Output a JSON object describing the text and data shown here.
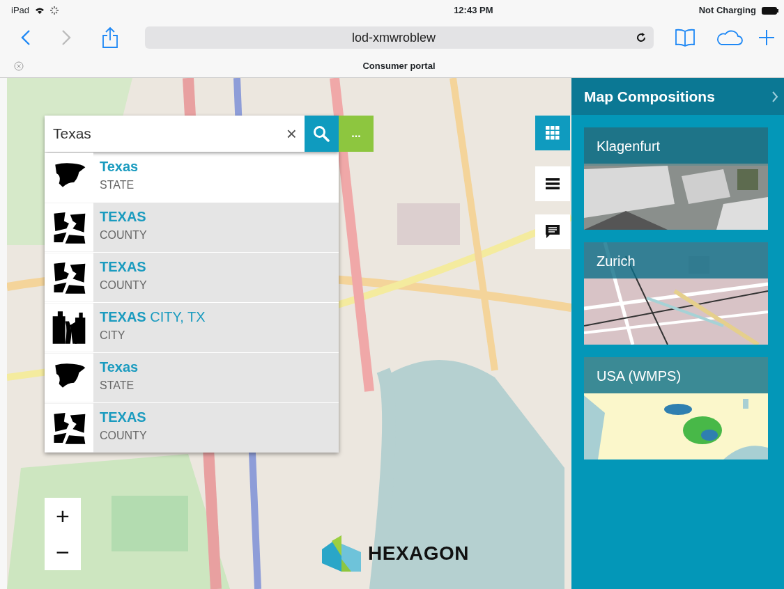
{
  "status_bar": {
    "device": "iPad",
    "time": "12:43 PM",
    "battery": "Not Charging"
  },
  "browser": {
    "back_enabled": true,
    "forward_enabled": false,
    "url": "lod-xmwroblew",
    "tab_title": "Consumer portal"
  },
  "search": {
    "value": "Texas",
    "clear": "×",
    "more": "..."
  },
  "results": [
    {
      "match": "Texas",
      "type": "STATE",
      "kind": "state",
      "selected": true
    },
    {
      "match": "TEXAS",
      "type": "COUNTY",
      "kind": "county",
      "selected": false
    },
    {
      "match": "TEXAS",
      "type": "COUNTY",
      "kind": "county",
      "selected": false
    },
    {
      "match": "TEXAS",
      "rest": " CITY, TX",
      "type": "CITY",
      "kind": "city",
      "selected": false
    },
    {
      "match": "Texas",
      "type": "STATE",
      "kind": "state",
      "selected": false
    },
    {
      "match": "TEXAS",
      "type": "COUNTY",
      "kind": "county",
      "selected": false
    }
  ],
  "zoom": {
    "in": "+",
    "out": "−"
  },
  "logo": {
    "text": "HEXAGON"
  },
  "panel": {
    "title": "Map Compositions",
    "compositions": [
      {
        "name": "Klagenfurt",
        "kind": "aerial"
      },
      {
        "name": "Zurich",
        "kind": "street"
      },
      {
        "name": "USA (WMPS)",
        "kind": "weather"
      }
    ]
  }
}
